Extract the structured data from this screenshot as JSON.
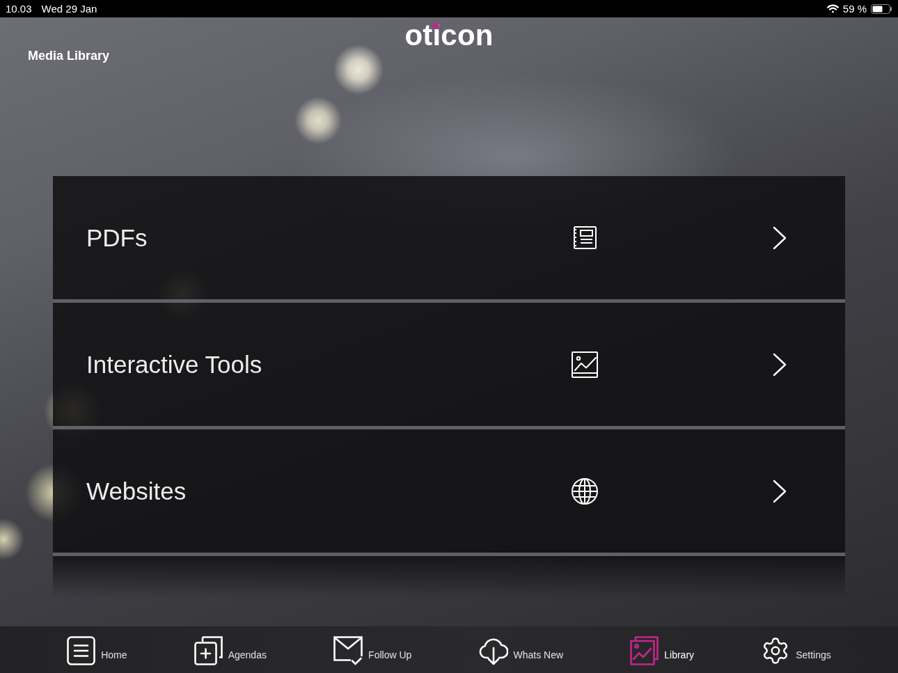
{
  "status_bar": {
    "time": "10.03",
    "date": "Wed 29 Jan",
    "battery": "59 %"
  },
  "header": {
    "logo": "oticon",
    "title": "Media Library"
  },
  "list": [
    {
      "title": "PDFs"
    },
    {
      "title": "Interactive Tools"
    },
    {
      "title": "Websites"
    }
  ],
  "tab_bar": [
    {
      "label": "Home",
      "selected": false
    },
    {
      "label": "Agendas",
      "selected": false
    },
    {
      "label": "Follow Up",
      "selected": false
    },
    {
      "label": "Whats New",
      "selected": false
    },
    {
      "label": "Library",
      "selected": true
    },
    {
      "label": "Settings",
      "selected": false
    }
  ]
}
